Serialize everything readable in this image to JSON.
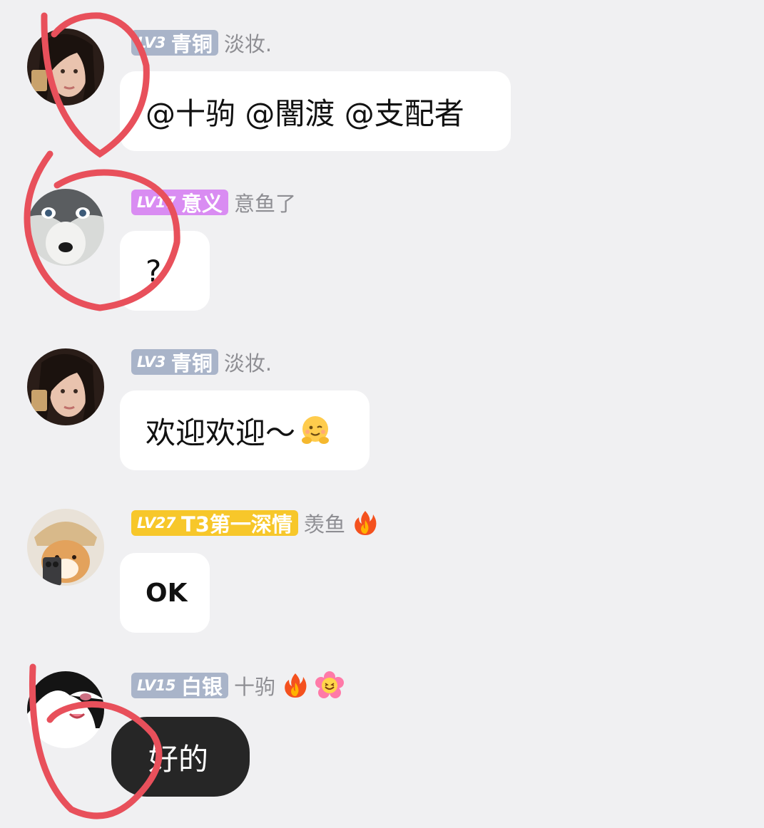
{
  "messages": [
    {
      "level": "LV3",
      "badge_title": "青铜",
      "badge_color": "#a9b4c9",
      "username": "淡妆.",
      "text": "@十驹 @闇渡 @支配者"
    },
    {
      "level": "LV17",
      "badge_title": "意义",
      "badge_color": "#d98cf2",
      "username": "意鱼了",
      "text": "?"
    },
    {
      "level": "LV3",
      "badge_title": "青铜",
      "badge_color": "#a9b4c9",
      "username": "淡妆.",
      "text": "欢迎欢迎～"
    },
    {
      "level": "LV27",
      "badge_title": "T3第一深情",
      "badge_color": "#f7c72a",
      "username": "羡鱼",
      "text": "OK"
    },
    {
      "level": "LV15",
      "badge_title": "白银",
      "badge_color": "#a9b4c9",
      "username": "十驹",
      "text": "好的"
    }
  ],
  "colors": {
    "background": "#f0f0f2",
    "bubble": "#ffffff",
    "bubble_dark": "#262626",
    "username": "#8e8e93",
    "annotation": "#e8505b"
  },
  "icons": [
    "fire-icon",
    "flower-smile-icon",
    "hug-emoji-icon"
  ]
}
